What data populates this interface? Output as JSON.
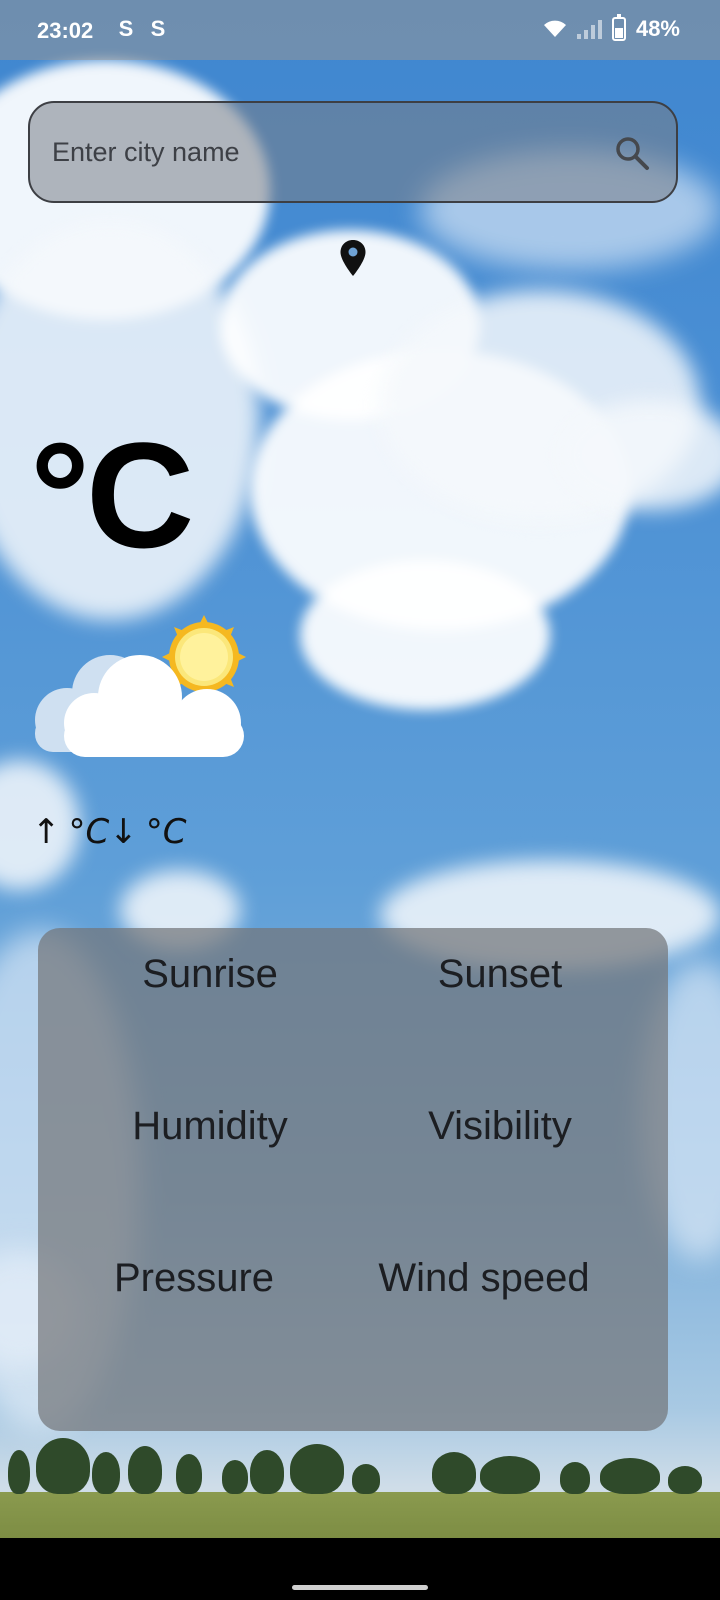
{
  "status_bar": {
    "time": "23:02",
    "battery": "48%",
    "app_icons": [
      "S",
      "S"
    ]
  },
  "search": {
    "placeholder": "Enter city name",
    "value": ""
  },
  "weather": {
    "temperature_unit": "°C",
    "max_arrow": "↑",
    "min_arrow": "↓",
    "max_unit": "°C",
    "min_unit": "°C"
  },
  "details": {
    "sunrise": "Sunrise",
    "sunset": "Sunset",
    "humidity": "Humidity",
    "visibility": "Visibility",
    "pressure": "Pressure",
    "wind_speed": "Wind speed"
  },
  "icons": {
    "search": "search-icon",
    "location": "location-pin-icon",
    "weather": "partly-cloudy-icon",
    "wifi": "wifi-icon",
    "signal": "cellular-signal-icon",
    "battery": "battery-charging-icon"
  },
  "colors": {
    "sky": "#4a8fd4",
    "card": "#73767a",
    "text": "#1c1e22",
    "sun": "#f7c82b"
  }
}
